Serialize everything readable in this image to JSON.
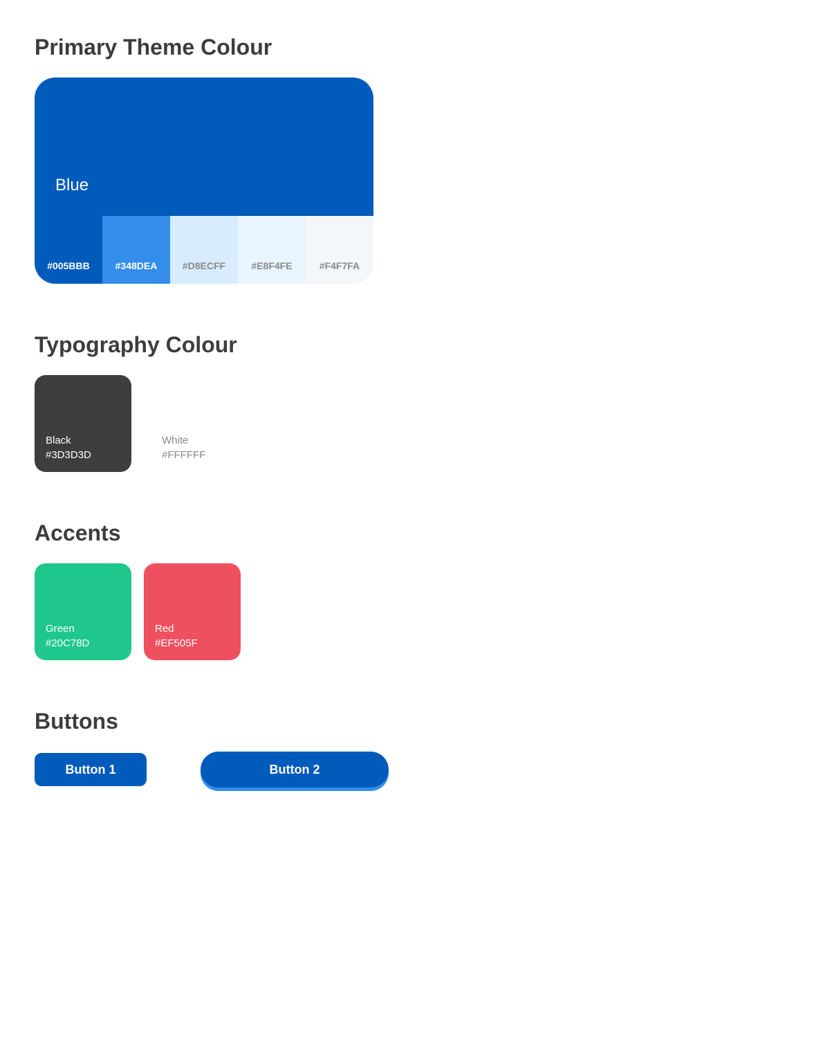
{
  "primary": {
    "title": "Primary Theme Colour",
    "name": "Blue",
    "shades": [
      {
        "hex": "#005BBB"
      },
      {
        "hex": "#348DEA"
      },
      {
        "hex": "#D8ECFF"
      },
      {
        "hex": "#E8F4FE"
      },
      {
        "hex": "#F4F7FA"
      }
    ]
  },
  "typography": {
    "title": "Typography Colour",
    "swatches": [
      {
        "name": "Black",
        "hex": "#3D3D3D"
      },
      {
        "name": "White",
        "hex": "#FFFFFF"
      }
    ]
  },
  "accents": {
    "title": "Accents",
    "swatches": [
      {
        "name": "Green",
        "hex": "#20C78D"
      },
      {
        "name": "Red",
        "hex": "#EF505F"
      }
    ]
  },
  "buttons": {
    "title": "Buttons",
    "btn1": "Button 1",
    "btn2": "Button 2"
  }
}
